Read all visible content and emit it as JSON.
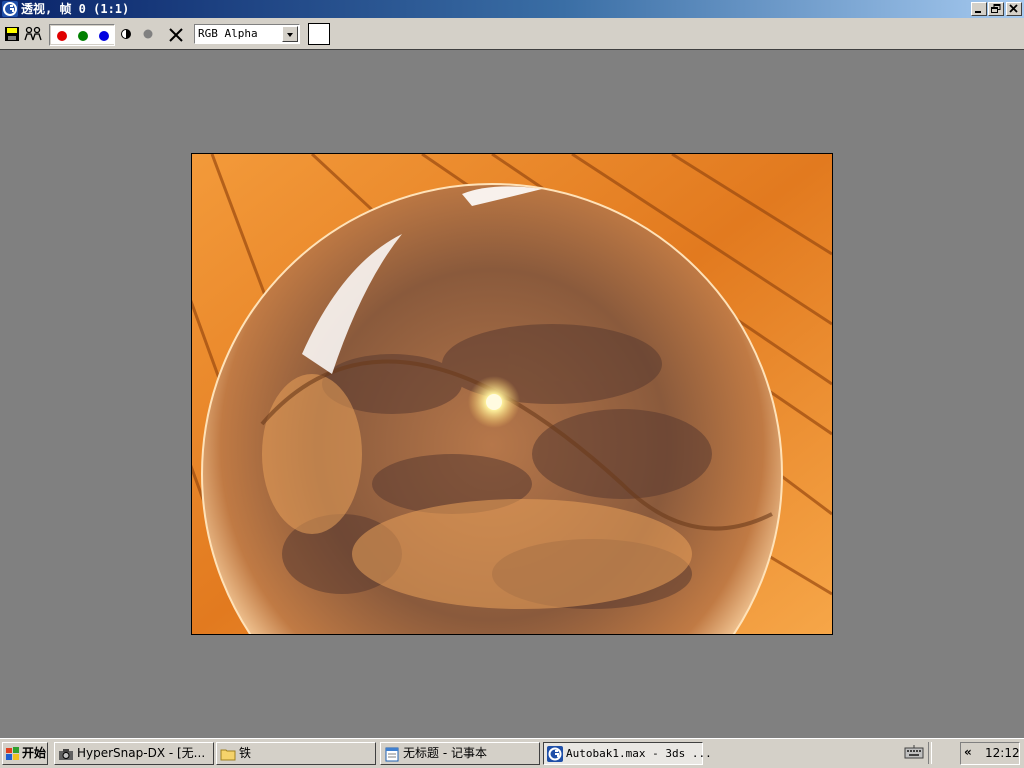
{
  "window": {
    "title": "透视, 帧 0 (1:1)",
    "app_icon": "3dsmax-icon",
    "controls": [
      "minimize-icon",
      "restore-icon",
      "close-icon"
    ]
  },
  "toolbar": {
    "save_icon": "save-icon",
    "clone_icon": "clone-icon",
    "channels": [
      {
        "name": "red",
        "color": "#e00000"
      },
      {
        "name": "green",
        "color": "#008000"
      },
      {
        "name": "blue",
        "color": "#0000e0"
      }
    ],
    "mono_icon": "mono-icon",
    "alpha_icon": "alpha-dot-icon",
    "clear_icon": "clear-x-icon",
    "channel_select": "RGB Alpha",
    "swatch_color": "#ffffff"
  },
  "taskbar": {
    "start_label": "开始",
    "tasks": [
      {
        "label": "HyperSnap-DX - [无...",
        "icon": "camera-icon",
        "active": false
      },
      {
        "label": "铁",
        "icon": "folder-icon",
        "active": false
      },
      {
        "label": "无标题 - 记事本",
        "icon": "notepad-icon",
        "active": false
      },
      {
        "label": "Autobak1.max - 3ds ...",
        "icon": "3dsmax-icon",
        "active": true
      }
    ],
    "tray_expand": "«",
    "clock": "12:12",
    "keyboard_icon": "keyboard-icon"
  }
}
